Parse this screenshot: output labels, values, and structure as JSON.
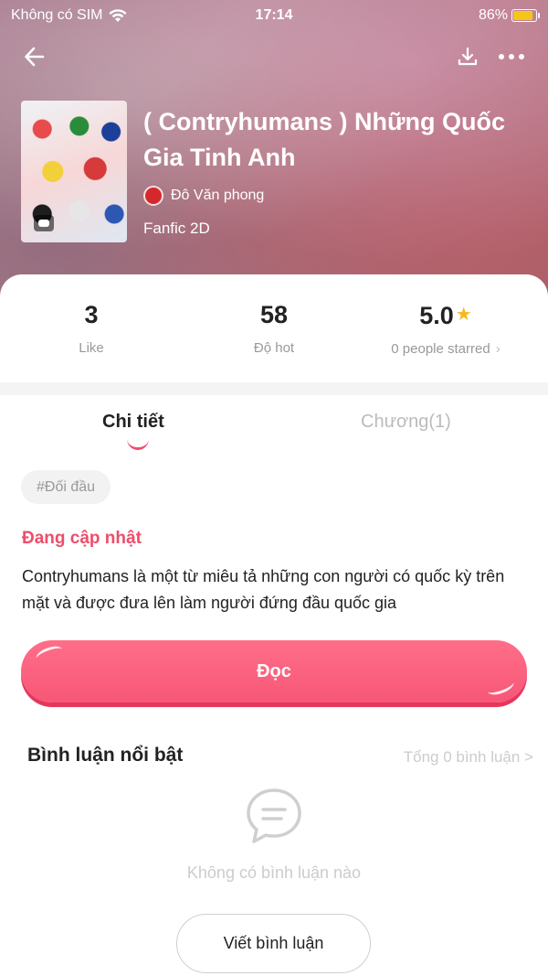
{
  "status_bar": {
    "carrier": "Không có SIM",
    "time": "17:14",
    "battery": "86%",
    "battery_level": 0.86
  },
  "nav": {
    "back_icon": "arrow-left-icon",
    "download_icon": "download-icon",
    "more_icon": "more-dots-icon"
  },
  "book": {
    "title": "( Contryhumans ) Những Quốc Gia Tinh Anh",
    "author": "Đô Văn phong",
    "category": "Fanfic 2D"
  },
  "stats": {
    "likes_value": "3",
    "likes_label": "Like",
    "hot_value": "58",
    "hot_label": "Độ hot",
    "rating_value": "5.0",
    "rating_label": "0 people starred",
    "rating_chevron": "›"
  },
  "tabs": {
    "details": "Chi tiết",
    "chapters": "Chương(1)"
  },
  "tag": "#Đối đầu",
  "update_status": "Đang cập nhật",
  "description": "Contryhumans là một từ miêu tả những con người có quốc kỳ trên mặt và được đưa lên làm người đứng đầu quốc gia",
  "read_button": "Đọc",
  "comments": {
    "title": "Bình luận nổi bật",
    "total": "Tổng 0 bình luận >",
    "empty": "Không có bình luận nào",
    "write_button": "Viết bình luận"
  },
  "colors": {
    "accent": "#f75777",
    "status_text": "#ee4d6a",
    "star": "#f5b920"
  }
}
